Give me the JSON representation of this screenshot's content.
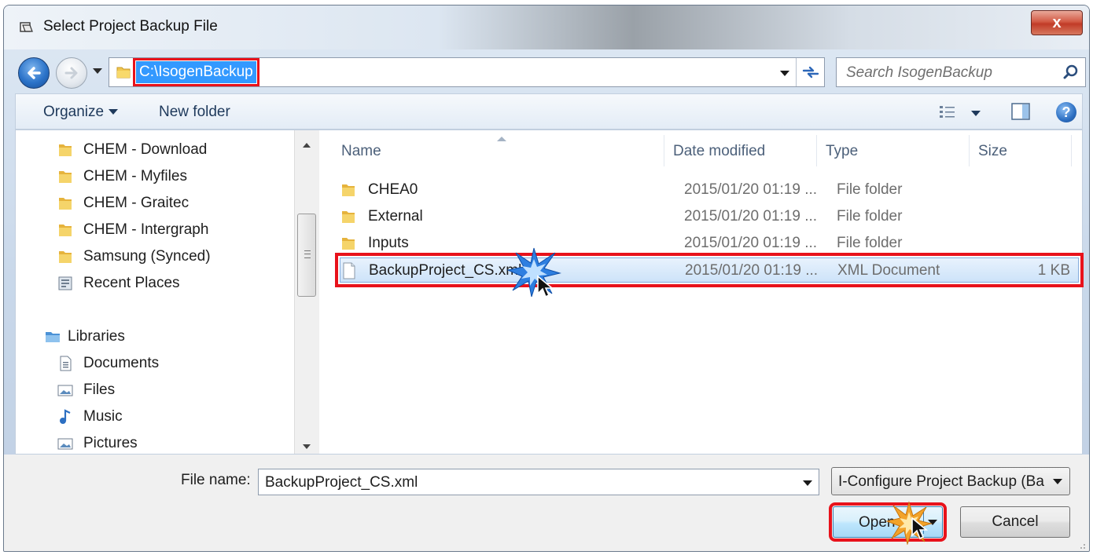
{
  "window": {
    "title": "Select Project Backup File",
    "close_label": "x"
  },
  "nav": {
    "address_path": "C:\\IsogenBackup",
    "search_placeholder": "Search IsogenBackup"
  },
  "toolbar": {
    "organize_label": "Organize",
    "new_folder_label": "New folder",
    "help_label": "?"
  },
  "sidebar": {
    "items": [
      {
        "label": "CHEM - Download",
        "icon": "folder-icon"
      },
      {
        "label": "CHEM - Myfiles",
        "icon": "folder-icon"
      },
      {
        "label": "CHEM - Graitec",
        "icon": "folder-icon"
      },
      {
        "label": "CHEM - Intergraph",
        "icon": "folder-icon"
      },
      {
        "label": "Samsung (Synced)",
        "icon": "folder-icon"
      },
      {
        "label": "Recent Places",
        "icon": "recent-places-icon"
      },
      {
        "label": "Libraries",
        "icon": "libraries-icon"
      },
      {
        "label": "Documents",
        "icon": "documents-icon"
      },
      {
        "label": "Files",
        "icon": "pictures-icon"
      },
      {
        "label": "Music",
        "icon": "music-icon"
      },
      {
        "label": "Pictures",
        "icon": "pictures-icon"
      }
    ]
  },
  "files": {
    "columns": {
      "name": "Name",
      "date": "Date modified",
      "type": "Type",
      "size": "Size"
    },
    "rows": [
      {
        "name": "CHEA0",
        "date": "2015/01/20 01:19 ...",
        "type": "File folder",
        "size": "",
        "icon": "folder-icon"
      },
      {
        "name": "External",
        "date": "2015/01/20 01:19 ...",
        "type": "File folder",
        "size": "",
        "icon": "folder-icon"
      },
      {
        "name": "Inputs",
        "date": "2015/01/20 01:19 ...",
        "type": "File folder",
        "size": "",
        "icon": "folder-icon"
      },
      {
        "name": "BackupProject_CS.xml",
        "date": "2015/01/20 01:19 ...",
        "type": "XML Document",
        "size": "1 KB",
        "icon": "xml-file-icon",
        "selected": true
      }
    ]
  },
  "bottom": {
    "file_name_label": "File name:",
    "file_name_value": "BackupProject_CS.xml",
    "file_type_value": "I-Configure Project Backup (Ba",
    "open_label": "Open",
    "cancel_label": "Cancel"
  },
  "colors": {
    "highlight_red": "#e8121b",
    "selection_blue": "#3399ff",
    "accent_blue": "#2b73c9"
  }
}
